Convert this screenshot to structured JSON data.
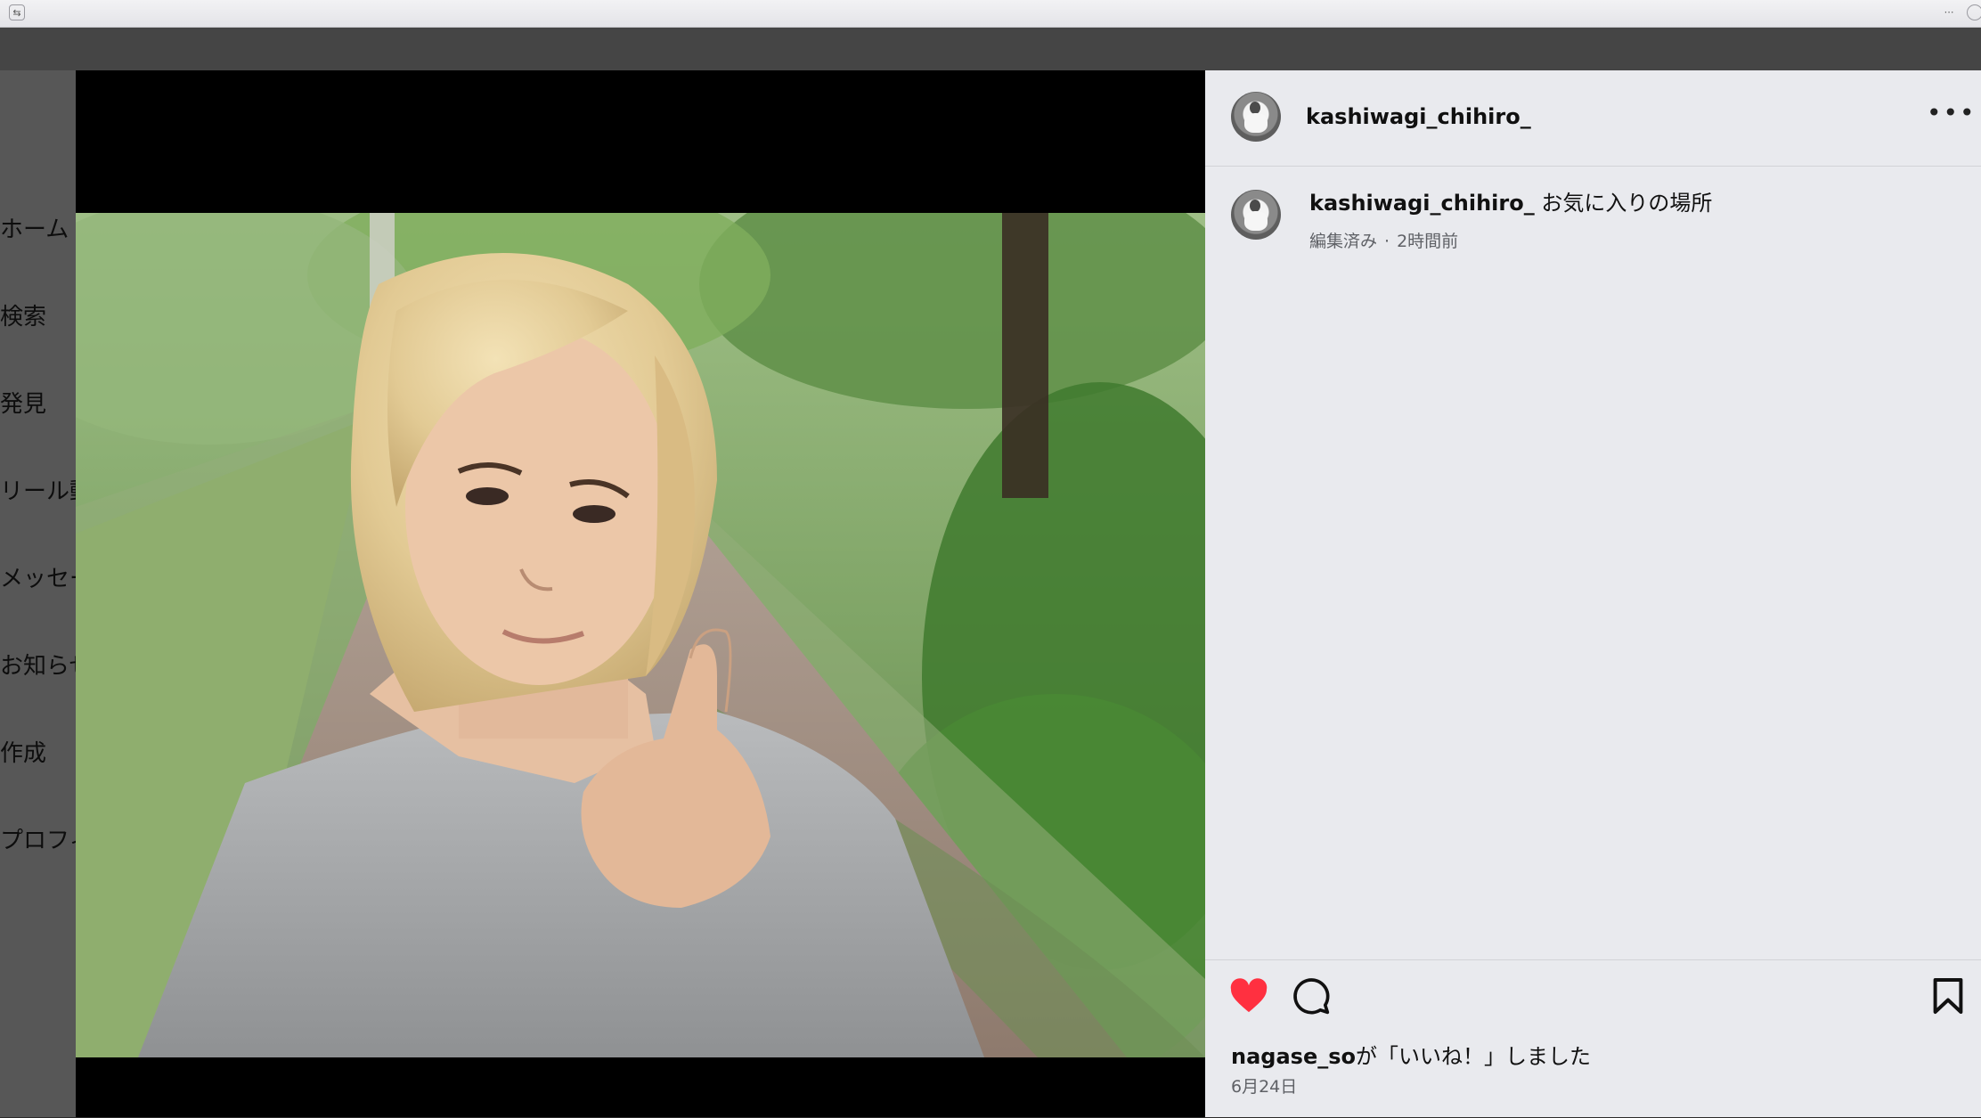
{
  "sidebar": {
    "items": [
      {
        "label": "ホーム"
      },
      {
        "label": "検索"
      },
      {
        "label": "発見"
      },
      {
        "label": "リール動画"
      },
      {
        "label": "メッセージ"
      },
      {
        "label": "お知らせ"
      },
      {
        "label": "作成"
      },
      {
        "label": "プロフィール"
      }
    ]
  },
  "post": {
    "author": "kashiwagi_chihiro_",
    "caption_user": "kashiwagi_chihiro_",
    "caption_text": "お気に入りの場所",
    "edited_label": "編集済み",
    "separator": "·",
    "time_ago": "2時間前",
    "liked_by_user": "nagase_so",
    "liked_by_suffix": "が「いいね！」しました",
    "date": "6月24日",
    "liked": true
  },
  "icons": {
    "more": "more-horizontal-icon",
    "like": "heart-icon",
    "comment": "comment-icon",
    "save": "bookmark-icon"
  },
  "colors": {
    "like_red": "#ff3040",
    "panel_bg": "#e9eaee"
  }
}
